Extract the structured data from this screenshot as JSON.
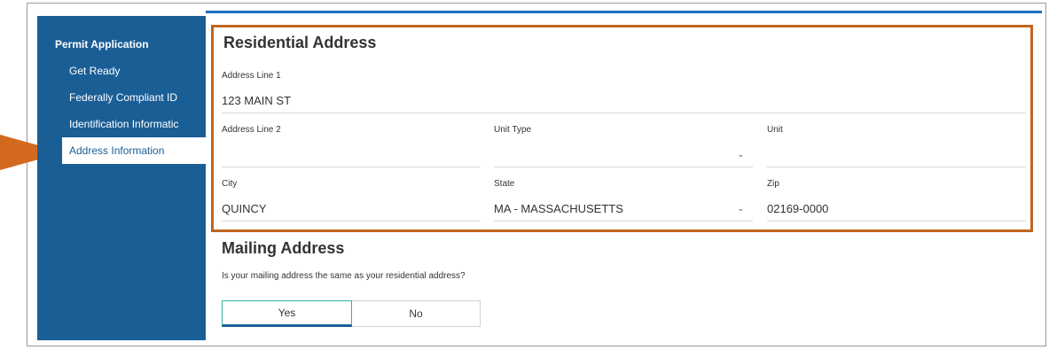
{
  "sidebar": {
    "heading": "Permit Application",
    "items": [
      {
        "label": "Get Ready"
      },
      {
        "label": "Federally Compliant ID"
      },
      {
        "label": "Identification Informatic"
      },
      {
        "label": "Address Information"
      }
    ]
  },
  "residential": {
    "title": "Residential Address",
    "fields": {
      "address_line_1": {
        "label": "Address Line 1",
        "value": "123 MAIN ST"
      },
      "address_line_2": {
        "label": "Address Line 2",
        "value": ""
      },
      "unit_type": {
        "label": "Unit Type",
        "value": ""
      },
      "unit": {
        "label": "Unit",
        "value": ""
      },
      "city": {
        "label": "City",
        "value": "QUINCY"
      },
      "state": {
        "label": "State",
        "value": "MA - MASSACHUSETTS"
      },
      "zip": {
        "label": "Zip",
        "value": "02169-0000"
      }
    }
  },
  "mailing": {
    "title": "Mailing Address",
    "question": "Is your mailing address the same as your residential address?",
    "yes_label": "Yes",
    "no_label": "No",
    "selected": "Yes"
  },
  "colors": {
    "sidebar_bg": "#1a5e96",
    "highlight": "#c0651f",
    "accent": "#1e6fbf"
  }
}
